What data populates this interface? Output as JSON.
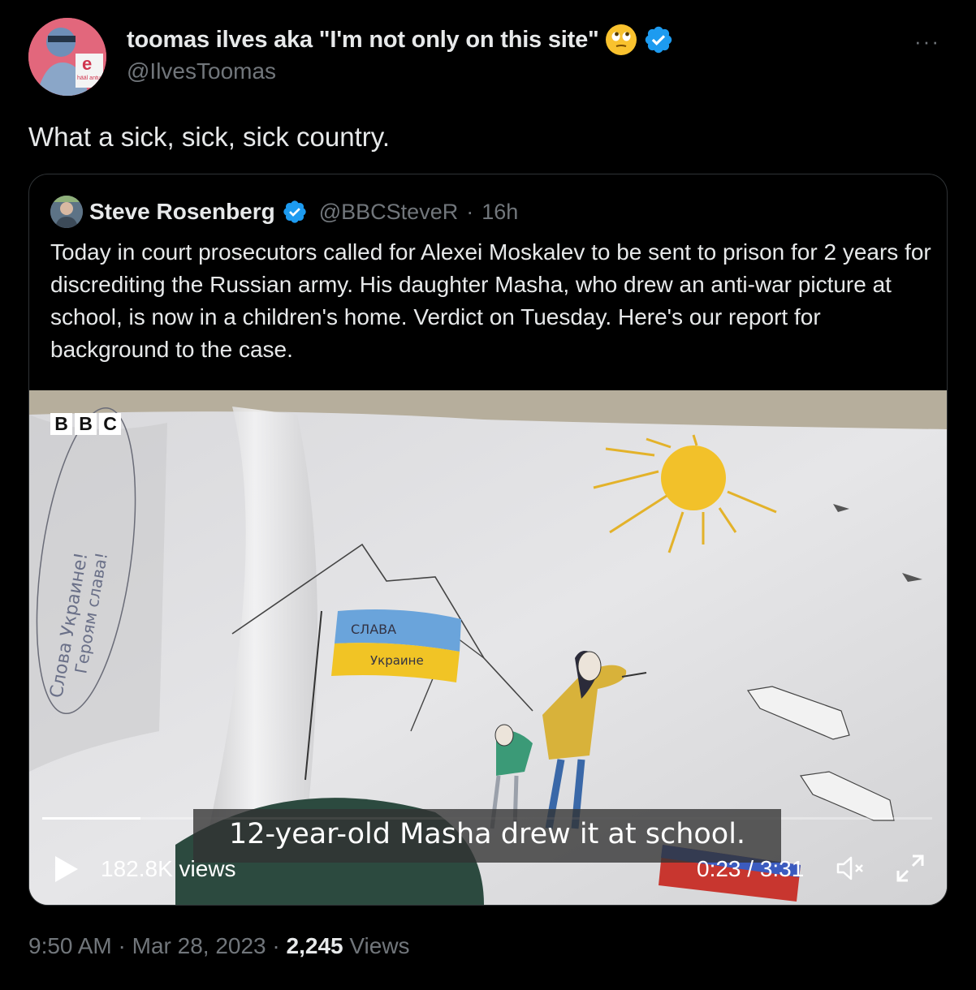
{
  "author": {
    "display_name": "toomas ilves aka \"I'm not only on this site\"",
    "handle": "@IlvesToomas",
    "emoji": "rolling-eyes-emoji",
    "verified_icon": "verified-badge-icon",
    "avatar_badge": "e",
    "avatar_badge_sub": "hääl antud"
  },
  "more_label": "···",
  "tweet_text": "What a sick, sick, sick country.",
  "quoted": {
    "display_name": "Steve Rosenberg",
    "handle": "@BBCSteveR",
    "separator": "·",
    "time": "16h",
    "text": "Today in court prosecutors called for Alexei Moskalev to be sent to prison for 2 years for discrediting the Russian army. His daughter Masha, who drew an anti-war picture at school, is now in a children's home. Verdict on Tuesday. Here's our report for background to the case."
  },
  "video": {
    "logo_letters": [
      "B",
      "B",
      "C"
    ],
    "caption": "12-year-old Masha drew it at school.",
    "views": "182.8K views",
    "time": "0:23 / 3:31",
    "progress": 0.11,
    "drawing_text": {
      "flag_top": "СЛАВА",
      "flag_bottom": "Украине",
      "margin_line1": "Слова Украине!",
      "margin_line2": "Героям слава!"
    }
  },
  "footer": {
    "time": "9:50 AM",
    "sep1": "·",
    "date": "Mar 28, 2023",
    "sep2": "·",
    "views_count": "2,245",
    "views_label": "Views"
  },
  "colors": {
    "background": "#000000",
    "text_primary": "#e7e9ea",
    "text_secondary": "#71767b",
    "verified_blue": "#1d9bf0",
    "border": "#2f3336"
  }
}
